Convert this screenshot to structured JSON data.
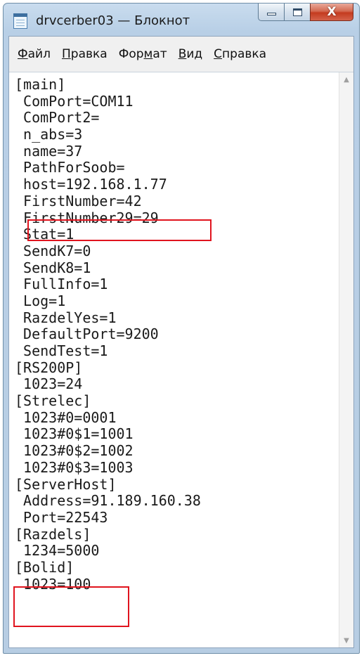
{
  "window": {
    "title": "drvcerber03 — Блокнот",
    "caption_buttons": {
      "minimize": "minimize-icon",
      "maximize": "maximize-icon",
      "close": "X"
    }
  },
  "menu": {
    "items": [
      {
        "label_pre": "",
        "label_key": "Ф",
        "label_post": "айл"
      },
      {
        "label_pre": "",
        "label_key": "П",
        "label_post": "равка"
      },
      {
        "label_pre": "Фор",
        "label_key": "м",
        "label_post": "ат"
      },
      {
        "label_pre": "",
        "label_key": "В",
        "label_post": "ид"
      },
      {
        "label_pre": "",
        "label_key": "С",
        "label_post": "правка"
      }
    ]
  },
  "document": {
    "lines": [
      "[main]",
      " ComPort=COM11",
      " ComPort2=",
      " n_abs=3",
      " name=37",
      " PathForSoob=",
      " host=192.168.1.77",
      " FirstNumber=42",
      " FirstNumber29=29",
      " Stat=1",
      " SendK7=0",
      " SendK8=1",
      " FullInfo=1",
      " Log=1",
      " RazdelYes=1",
      " DefaultPort=9200",
      " SendTest=1",
      "[RS200P]",
      " 1023=24",
      "[Strelec]",
      " 1023#0=0001",
      " 1023#0$1=1001",
      " 1023#0$2=1002",
      " 1023#0$3=1003",
      "[ServerHost]",
      " Address=91.189.160.38",
      " Port=22543",
      "[Razdels]",
      " 1234=5000",
      "[Bolid]",
      " 1023=100"
    ]
  },
  "colors": {
    "highlight": "#e0141e",
    "titlebar": "#b8cfe6",
    "close": "#c43b1f"
  }
}
